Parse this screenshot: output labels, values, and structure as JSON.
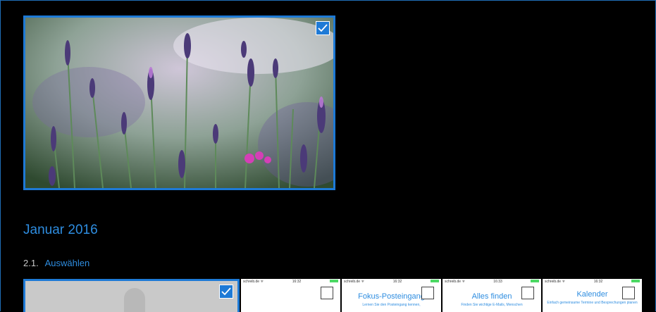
{
  "gallery": {
    "featured_image": {
      "alt": "lavender-photo",
      "selected": true
    },
    "section_title": "Januar 2016",
    "subsection": {
      "number": "2.1.",
      "label": "Auswählen"
    },
    "thumbnails": [
      {
        "selected": true,
        "title": "",
        "desc": ""
      },
      {
        "status_left": "schreib.de ᯤ",
        "status_time": "16:32",
        "title": "",
        "desc": ""
      },
      {
        "status_left": "schreib.de ᯤ",
        "status_time": "16:32",
        "title": "Fokus-Posteingang",
        "desc": "Lernen Sie den Posteingang kennen,"
      },
      {
        "status_left": "schreib.de ᯤ",
        "status_time": "16:33",
        "title": "Alles finden",
        "desc": "Finden Sie wichtige E-Mails, Menschen"
      },
      {
        "status_left": "schreib.de ᯤ",
        "status_time": "16:32",
        "title": "Kalender",
        "desc": "Einfach gemeinsame Termine und Besprechungen planen"
      }
    ]
  },
  "colors": {
    "accent": "#1e7ad6",
    "text_accent": "#2e8de0",
    "background": "#000000"
  }
}
